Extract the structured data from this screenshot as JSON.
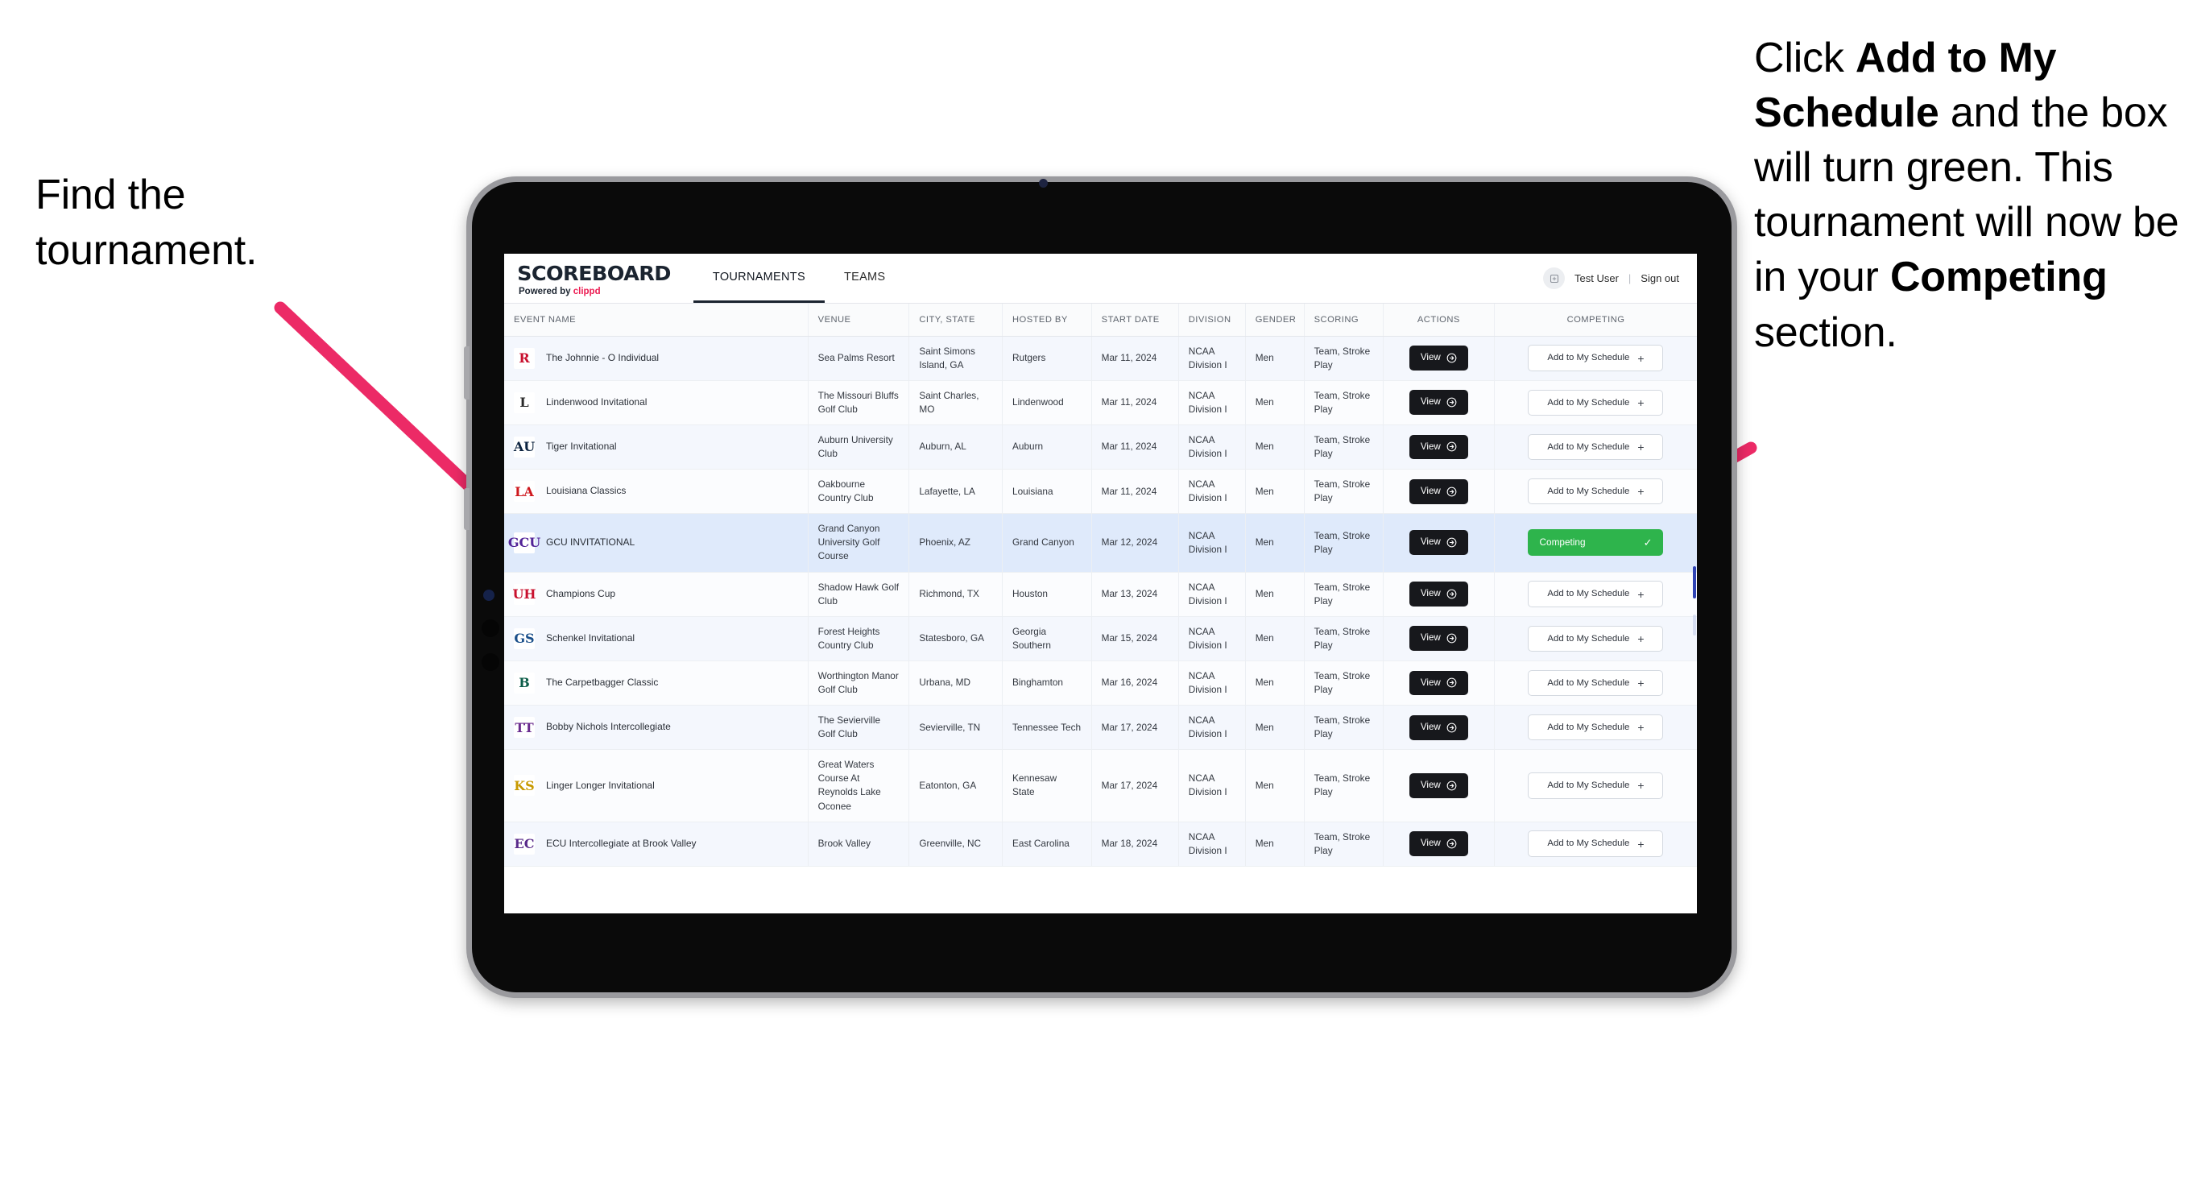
{
  "annotations": {
    "left": "Find the tournament.",
    "right_parts": [
      {
        "text": "Click ",
        "bold": false
      },
      {
        "text": "Add to My Schedule",
        "bold": true
      },
      {
        "text": " and the box will turn green. This tournament will now be in your ",
        "bold": false
      },
      {
        "text": "Competing",
        "bold": true
      },
      {
        "text": " section.",
        "bold": false
      }
    ],
    "arrow_color": "#ec2a66"
  },
  "app": {
    "brand": {
      "name": "SCOREBOARD",
      "powered_prefix": "Powered by ",
      "powered_brand": "clippd"
    },
    "tabs": [
      {
        "label": "TOURNAMENTS",
        "active": true
      },
      {
        "label": "TEAMS",
        "active": false
      }
    ],
    "user": {
      "avatar_icon": "user-avatar-icon",
      "name": "Test User",
      "separator": "|",
      "signout": "Sign out"
    },
    "table": {
      "columns": [
        "EVENT NAME",
        "VENUE",
        "CITY, STATE",
        "HOSTED BY",
        "START DATE",
        "DIVISION",
        "GENDER",
        "SCORING",
        "ACTIONS",
        "COMPETING"
      ],
      "view_label": "View",
      "add_label": "Add to My Schedule",
      "competing_label": "Competing",
      "rows": [
        {
          "logo_text": "R",
          "logo_color": "#c8102e",
          "logo_bg": "#ffffff",
          "event": "The Johnnie - O Individual",
          "venue": "Sea Palms Resort",
          "city": "Saint Simons Island, GA",
          "hosted_by": "Rutgers",
          "start_date": "Mar 11, 2024",
          "division": "NCAA Division I",
          "gender": "Men",
          "scoring": "Team, Stroke Play",
          "competing": false
        },
        {
          "logo_text": "L",
          "logo_color": "#2a2a2a",
          "logo_bg": "#ffffff",
          "event": "Lindenwood Invitational",
          "venue": "The Missouri Bluffs Golf Club",
          "city": "Saint Charles, MO",
          "hosted_by": "Lindenwood",
          "start_date": "Mar 11, 2024",
          "division": "NCAA Division I",
          "gender": "Men",
          "scoring": "Team, Stroke Play",
          "competing": false
        },
        {
          "logo_text": "AU",
          "logo_color": "#0c2340",
          "logo_bg": "#ffffff",
          "event": "Tiger Invitational",
          "venue": "Auburn University Club",
          "city": "Auburn, AL",
          "hosted_by": "Auburn",
          "start_date": "Mar 11, 2024",
          "division": "NCAA Division I",
          "gender": "Men",
          "scoring": "Team, Stroke Play",
          "competing": false
        },
        {
          "logo_text": "LA",
          "logo_color": "#ce181e",
          "logo_bg": "#ffffff",
          "event": "Louisiana Classics",
          "venue": "Oakbourne Country Club",
          "city": "Lafayette, LA",
          "hosted_by": "Louisiana",
          "start_date": "Mar 11, 2024",
          "division": "NCAA Division I",
          "gender": "Men",
          "scoring": "Team, Stroke Play",
          "competing": false
        },
        {
          "logo_text": "GCU",
          "logo_color": "#522398",
          "logo_bg": "#ffffff",
          "event": "GCU INVITATIONAL",
          "venue": "Grand Canyon University Golf Course",
          "city": "Phoenix, AZ",
          "hosted_by": "Grand Canyon",
          "start_date": "Mar 12, 2024",
          "division": "NCAA Division I",
          "gender": "Men",
          "scoring": "Team, Stroke Play",
          "competing": true
        },
        {
          "logo_text": "UH",
          "logo_color": "#c8102e",
          "logo_bg": "#ffffff",
          "event": "Champions Cup",
          "venue": "Shadow Hawk Golf Club",
          "city": "Richmond, TX",
          "hosted_by": "Houston",
          "start_date": "Mar 13, 2024",
          "division": "NCAA Division I",
          "gender": "Men",
          "scoring": "Team, Stroke Play",
          "competing": false
        },
        {
          "logo_text": "GS",
          "logo_color": "#1a4f8a",
          "logo_bg": "#ffffff",
          "event": "Schenkel Invitational",
          "venue": "Forest Heights Country Club",
          "city": "Statesboro, GA",
          "hosted_by": "Georgia Southern",
          "start_date": "Mar 15, 2024",
          "division": "NCAA Division I",
          "gender": "Men",
          "scoring": "Team, Stroke Play",
          "competing": false
        },
        {
          "logo_text": "B",
          "logo_color": "#0e5e4a",
          "logo_bg": "#ffffff",
          "event": "The Carpetbagger Classic",
          "venue": "Worthington Manor Golf Club",
          "city": "Urbana, MD",
          "hosted_by": "Binghamton",
          "start_date": "Mar 16, 2024",
          "division": "NCAA Division I",
          "gender": "Men",
          "scoring": "Team, Stroke Play",
          "competing": false
        },
        {
          "logo_text": "TT",
          "logo_color": "#6a2c8f",
          "logo_bg": "#ffffff",
          "event": "Bobby Nichols Intercollegiate",
          "venue": "The Sevierville Golf Club",
          "city": "Sevierville, TN",
          "hosted_by": "Tennessee Tech",
          "start_date": "Mar 17, 2024",
          "division": "NCAA Division I",
          "gender": "Men",
          "scoring": "Team, Stroke Play",
          "competing": false
        },
        {
          "logo_text": "KS",
          "logo_color": "#c79900",
          "logo_bg": "#ffffff",
          "event": "Linger Longer Invitational",
          "venue": "Great Waters Course At Reynolds Lake Oconee",
          "city": "Eatonton, GA",
          "hosted_by": "Kennesaw State",
          "start_date": "Mar 17, 2024",
          "division": "NCAA Division I",
          "gender": "Men",
          "scoring": "Team, Stroke Play",
          "competing": false
        },
        {
          "logo_text": "EC",
          "logo_color": "#592a8a",
          "logo_bg": "#ffffff",
          "event": "ECU Intercollegiate at Brook Valley",
          "venue": "Brook Valley",
          "city": "Greenville, NC",
          "hosted_by": "East Carolina",
          "start_date": "Mar 18, 2024",
          "division": "NCAA Division I",
          "gender": "Men",
          "scoring": "Team, Stroke Play",
          "competing": false
        }
      ]
    }
  }
}
